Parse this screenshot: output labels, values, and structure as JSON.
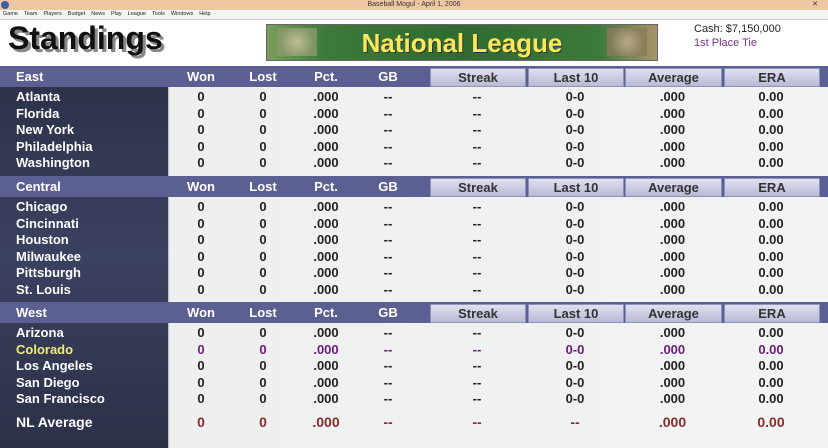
{
  "window": {
    "title": "Baseball Mogul - April 1, 2006"
  },
  "menu": [
    "Game",
    "Team",
    "Players",
    "Budget",
    "News",
    "Play",
    "League",
    "Tools",
    "Windows",
    "Help"
  ],
  "header": {
    "title": "Standings",
    "league": "National League",
    "cash": "Cash: $7,150,000",
    "place": "1st Place Tie"
  },
  "columns": {
    "won": "Won",
    "lost": "Lost",
    "pct": "Pct.",
    "gb": "GB",
    "streak": "Streak",
    "last10": "Last 10",
    "average": "Average",
    "era": "ERA"
  },
  "divisions": [
    {
      "name": "East",
      "teams": [
        {
          "name": "Atlanta",
          "won": "0",
          "lost": "0",
          "pct": ".000",
          "gb": "--",
          "streak": "--",
          "last10": "0-0",
          "avg": ".000",
          "era": "0.00"
        },
        {
          "name": "Florida",
          "won": "0",
          "lost": "0",
          "pct": ".000",
          "gb": "--",
          "streak": "--",
          "last10": "0-0",
          "avg": ".000",
          "era": "0.00"
        },
        {
          "name": "New York",
          "won": "0",
          "lost": "0",
          "pct": ".000",
          "gb": "--",
          "streak": "--",
          "last10": "0-0",
          "avg": ".000",
          "era": "0.00"
        },
        {
          "name": "Philadelphia",
          "won": "0",
          "lost": "0",
          "pct": ".000",
          "gb": "--",
          "streak": "--",
          "last10": "0-0",
          "avg": ".000",
          "era": "0.00"
        },
        {
          "name": "Washington",
          "won": "0",
          "lost": "0",
          "pct": ".000",
          "gb": "--",
          "streak": "--",
          "last10": "0-0",
          "avg": ".000",
          "era": "0.00"
        }
      ]
    },
    {
      "name": "Central",
      "teams": [
        {
          "name": "Chicago",
          "won": "0",
          "lost": "0",
          "pct": ".000",
          "gb": "--",
          "streak": "--",
          "last10": "0-0",
          "avg": ".000",
          "era": "0.00"
        },
        {
          "name": "Cincinnati",
          "won": "0",
          "lost": "0",
          "pct": ".000",
          "gb": "--",
          "streak": "--",
          "last10": "0-0",
          "avg": ".000",
          "era": "0.00"
        },
        {
          "name": "Houston",
          "won": "0",
          "lost": "0",
          "pct": ".000",
          "gb": "--",
          "streak": "--",
          "last10": "0-0",
          "avg": ".000",
          "era": "0.00"
        },
        {
          "name": "Milwaukee",
          "won": "0",
          "lost": "0",
          "pct": ".000",
          "gb": "--",
          "streak": "--",
          "last10": "0-0",
          "avg": ".000",
          "era": "0.00"
        },
        {
          "name": "Pittsburgh",
          "won": "0",
          "lost": "0",
          "pct": ".000",
          "gb": "--",
          "streak": "--",
          "last10": "0-0",
          "avg": ".000",
          "era": "0.00"
        },
        {
          "name": "St. Louis",
          "won": "0",
          "lost": "0",
          "pct": ".000",
          "gb": "--",
          "streak": "--",
          "last10": "0-0",
          "avg": ".000",
          "era": "0.00"
        }
      ]
    },
    {
      "name": "West",
      "teams": [
        {
          "name": "Arizona",
          "won": "0",
          "lost": "0",
          "pct": ".000",
          "gb": "--",
          "streak": "--",
          "last10": "0-0",
          "avg": ".000",
          "era": "0.00"
        },
        {
          "name": "Colorado",
          "won": "0",
          "lost": "0",
          "pct": ".000",
          "gb": "--",
          "streak": "--",
          "last10": "0-0",
          "avg": ".000",
          "era": "0.00",
          "highlight": true
        },
        {
          "name": "Los Angeles",
          "won": "0",
          "lost": "0",
          "pct": ".000",
          "gb": "--",
          "streak": "--",
          "last10": "0-0",
          "avg": ".000",
          "era": "0.00"
        },
        {
          "name": "San Diego",
          "won": "0",
          "lost": "0",
          "pct": ".000",
          "gb": "--",
          "streak": "--",
          "last10": "0-0",
          "avg": ".000",
          "era": "0.00"
        },
        {
          "name": "San Francisco",
          "won": "0",
          "lost": "0",
          "pct": ".000",
          "gb": "--",
          "streak": "--",
          "last10": "0-0",
          "avg": ".000",
          "era": "0.00"
        }
      ]
    }
  ],
  "average": {
    "name": "NL Average",
    "won": "0",
    "lost": "0",
    "pct": ".000",
    "gb": "--",
    "streak": "--",
    "last10": "--",
    "avg": ".000",
    "era": "0.00"
  },
  "colors": {
    "header_bar": "#5c5f92",
    "highlight_name": "#f0ec7a",
    "highlight_values": "#6c1a7a",
    "average_values": "#8a2a2a"
  }
}
